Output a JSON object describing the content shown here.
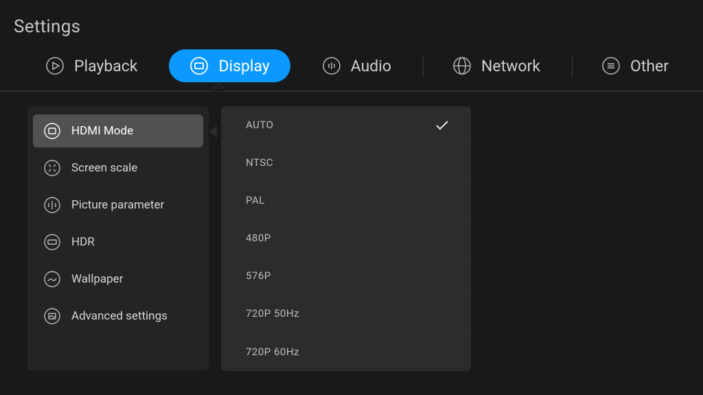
{
  "page_title": "Settings",
  "tabs": [
    {
      "id": "playback",
      "label": "Playback",
      "active": false
    },
    {
      "id": "display",
      "label": "Display",
      "active": true
    },
    {
      "id": "audio",
      "label": "Audio",
      "active": false
    },
    {
      "id": "network",
      "label": "Network",
      "active": false
    },
    {
      "id": "other",
      "label": "Other",
      "active": false
    }
  ],
  "left_menu": [
    {
      "id": "hdmi-mode",
      "label": "HDMI Mode",
      "selected": true
    },
    {
      "id": "screen-scale",
      "label": "Screen scale",
      "selected": false
    },
    {
      "id": "picture-parameter",
      "label": "Picture parameter",
      "selected": false
    },
    {
      "id": "hdr",
      "label": "HDR",
      "selected": false
    },
    {
      "id": "wallpaper",
      "label": "Wallpaper",
      "selected": false
    },
    {
      "id": "advanced-settings",
      "label": "Advanced settings",
      "selected": false
    }
  ],
  "options": [
    {
      "label": "AUTO",
      "checked": true
    },
    {
      "label": "NTSC",
      "checked": false
    },
    {
      "label": "PAL",
      "checked": false
    },
    {
      "label": "480P",
      "checked": false
    },
    {
      "label": "576P",
      "checked": false
    },
    {
      "label": "720P  50Hz",
      "checked": false
    },
    {
      "label": "720P  60Hz",
      "checked": false
    }
  ]
}
